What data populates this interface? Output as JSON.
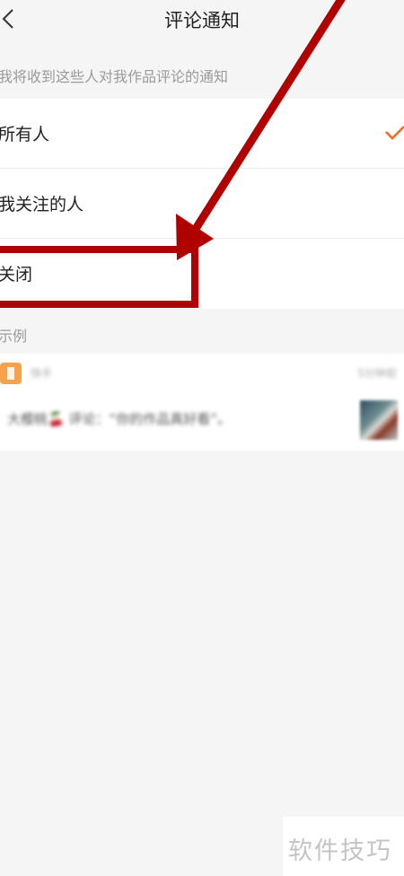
{
  "header": {
    "title": "评论通知"
  },
  "notify_section": {
    "label": "我将收到这些人对我作品评论的通知",
    "options": [
      {
        "label": "所有人",
        "selected": true
      },
      {
        "label": "我关注的人",
        "selected": false
      },
      {
        "label": "关闭",
        "selected": false
      }
    ]
  },
  "example_section": {
    "label": "示例",
    "card": {
      "app_name": "快手",
      "time": "5分钟前",
      "comment": "大樱桃🍒 评论：“你的作品真好看”。"
    }
  },
  "annotation": {
    "color": "#b00000",
    "highlighted_option": "关闭"
  },
  "accent_color": "#f26d21",
  "watermark": {
    "text": "软件技巧"
  }
}
